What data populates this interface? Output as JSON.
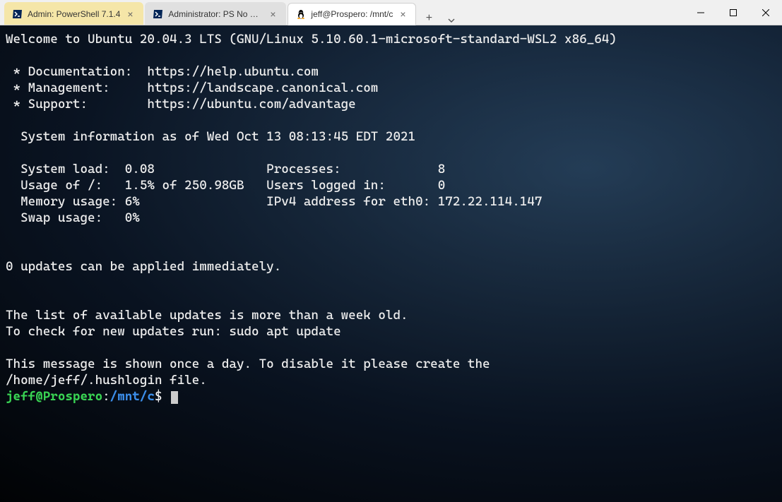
{
  "tabs": [
    {
      "label": "Admin: PowerShell 7.1.4",
      "icon": "ps"
    },
    {
      "label": "Administrator: PS No Profile",
      "icon": "ps"
    },
    {
      "label": "jeff@Prospero: /mnt/c",
      "icon": "tux"
    }
  ],
  "motd": {
    "welcome": "Welcome to Ubuntu 20.04.3 LTS (GNU/Linux 5.10.60.1-microsoft-standard-WSL2 x86_64)",
    "links": {
      "doc_label": " * Documentation:  ",
      "doc_url": "https://help.ubuntu.com",
      "mgmt_label": " * Management:     ",
      "mgmt_url": "https://landscape.canonical.com",
      "sup_label": " * Support:        ",
      "sup_url": "https://ubuntu.com/advantage"
    },
    "sysinfo_header": "  System information as of Wed Oct 13 08:13:45 EDT 2021",
    "stats_line1": "  System load:  0.08               Processes:             8",
    "stats_line2": "  Usage of /:   1.5% of 250.98GB   Users logged in:       0",
    "stats_line3": "  Memory usage: 6%                 IPv4 address for eth0: 172.22.114.147",
    "stats_line4": "  Swap usage:   0%",
    "updates": "0 updates can be applied immediately.",
    "stale1": "The list of available updates is more than a week old.",
    "stale2": "To check for new updates run: sudo apt update",
    "daily1": "This message is shown once a day. To disable it please create the",
    "daily2": "/home/jeff/.hushlogin file."
  },
  "prompt": {
    "userhost": "jeff@Prospero",
    "colon": ":",
    "path": "/mnt/c",
    "dollar": "$ "
  },
  "sysinfo_values": {
    "system_load": "0.08",
    "processes": "8",
    "usage_of_root": "1.5% of 250.98GB",
    "users_logged_in": "0",
    "memory_usage": "6%",
    "ipv4_eth0": "172.22.114.147",
    "swap_usage": "0%"
  }
}
